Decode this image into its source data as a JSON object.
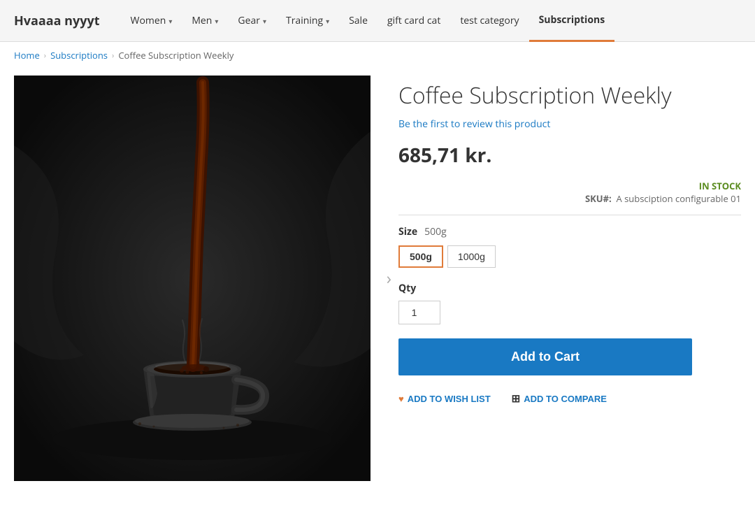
{
  "nav": {
    "logo": "Hvaaaa nyyyt",
    "items": [
      {
        "label": "Women",
        "hasDropdown": true,
        "active": false
      },
      {
        "label": "Men",
        "hasDropdown": true,
        "active": false
      },
      {
        "label": "Gear",
        "hasDropdown": true,
        "active": false
      },
      {
        "label": "Training",
        "hasDropdown": true,
        "active": false
      },
      {
        "label": "Sale",
        "hasDropdown": false,
        "active": false
      },
      {
        "label": "gift card cat",
        "hasDropdown": false,
        "active": false
      },
      {
        "label": "test category",
        "hasDropdown": false,
        "active": false
      },
      {
        "label": "Subscriptions",
        "hasDropdown": false,
        "active": true
      }
    ]
  },
  "breadcrumb": {
    "home": "Home",
    "parent": "Subscriptions",
    "current": "Coffee Subscription Weekly"
  },
  "product": {
    "title": "Coffee Subscription Weekly",
    "review_link": "Be the first to review this product",
    "price": "685,71 kr.",
    "stock_status": "IN STOCK",
    "sku_label": "SKU#:",
    "sku_value": "A subsciption configurable 01",
    "size_label": "Size",
    "selected_size": "500g",
    "sizes": [
      "500g",
      "1000g"
    ],
    "qty_label": "Qty",
    "qty_value": "1",
    "add_to_cart": "Add to Cart",
    "wish_list": "ADD TO WISH LIST",
    "compare": "ADD TO COMPARE"
  }
}
